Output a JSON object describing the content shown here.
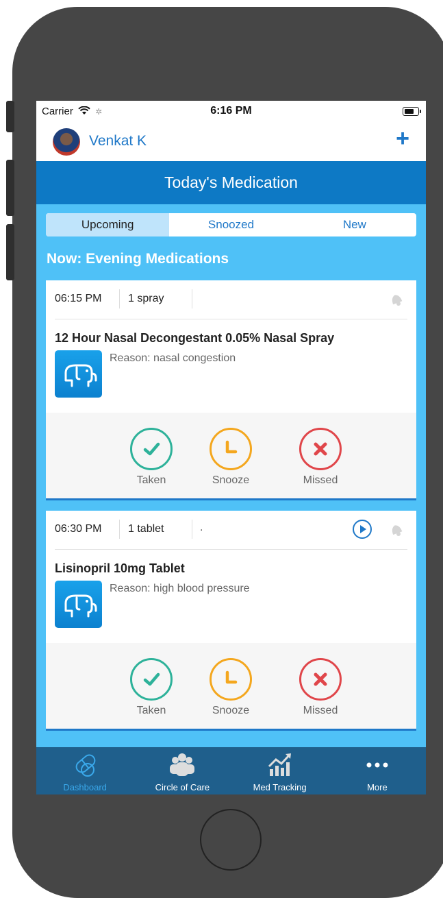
{
  "status_bar": {
    "carrier": "Carrier",
    "time": "6:16 PM"
  },
  "header": {
    "user_name": "Venkat K",
    "add_label": "+"
  },
  "title": "Today's Medication",
  "segments": [
    {
      "label": "Upcoming",
      "active": true
    },
    {
      "label": "Snoozed",
      "active": false
    },
    {
      "label": "New",
      "active": false
    }
  ],
  "section_title": "Now: Evening Medications",
  "cards": [
    {
      "time": "06:15 PM",
      "dose": "1 spray",
      "note": "",
      "name": "12 Hour Nasal Decongestant 0.05% Nasal Spray",
      "reason": "Reason: nasal congestion",
      "has_play": false
    },
    {
      "time": "06:30 PM",
      "dose": "1 tablet",
      "note": ".",
      "name": "Lisinopril 10mg Tablet",
      "reason": "Reason: high blood pressure",
      "has_play": true
    }
  ],
  "actions": {
    "taken": "Taken",
    "snooze": "Snooze",
    "missed": "Missed"
  },
  "colors": {
    "taken": "#2eb29a",
    "snooze": "#f4a71e",
    "missed": "#e0464a",
    "primary": "#1f78c8",
    "background": "#4fc1f7",
    "tabbar": "#1f5f8c"
  },
  "tabs": [
    {
      "label": "Dashboard",
      "icon": "pill-icon",
      "active": true
    },
    {
      "label": "Circle of Care",
      "icon": "people-icon",
      "active": false
    },
    {
      "label": "Med Tracking",
      "icon": "chart-icon",
      "active": false
    },
    {
      "label": "More",
      "icon": "more-icon",
      "active": false
    }
  ]
}
